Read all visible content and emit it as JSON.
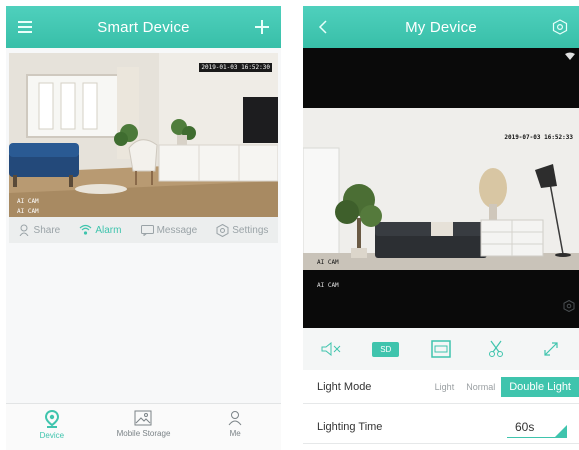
{
  "phone1": {
    "header": {
      "title": "Smart Device",
      "menu_icon": "menu-icon",
      "add_icon": "plus-icon"
    },
    "camera": {
      "timestamp": "2019-01-03 16:52:30",
      "label1": "AI CAM",
      "label2": "AI CAM"
    },
    "toolbar": [
      {
        "label": "Share",
        "icon": "share-icon",
        "active": false
      },
      {
        "label": "Alarm",
        "icon": "alarm-icon",
        "active": true
      },
      {
        "label": "Message",
        "icon": "message-icon",
        "active": false
      },
      {
        "label": "Settings",
        "icon": "settings-icon",
        "active": false
      }
    ],
    "nav": [
      {
        "label": "Device",
        "icon": "device-pin-icon",
        "active": true
      },
      {
        "label": "Mobile Storage",
        "icon": "image-icon",
        "active": false
      },
      {
        "label": "Me",
        "icon": "person-icon",
        "active": false
      }
    ]
  },
  "phone2": {
    "header": {
      "title": "My Device",
      "back_icon": "chevron-left-icon",
      "settings_icon": "settings-icon"
    },
    "camera": {
      "timestamp": "2019-07-03 16:52:33",
      "label_top": "AI CAM",
      "label_bottom": "AI CAM"
    },
    "controls": {
      "sd_label": "SD"
    },
    "light_mode": {
      "label": "Light Mode",
      "options": [
        "Light",
        "Normal",
        "Double Light"
      ],
      "selected": "Double Light"
    },
    "lighting_time": {
      "label": "Lighting Time",
      "value": "60s"
    },
    "colors": {
      "accent": "#3fc4ad"
    }
  }
}
